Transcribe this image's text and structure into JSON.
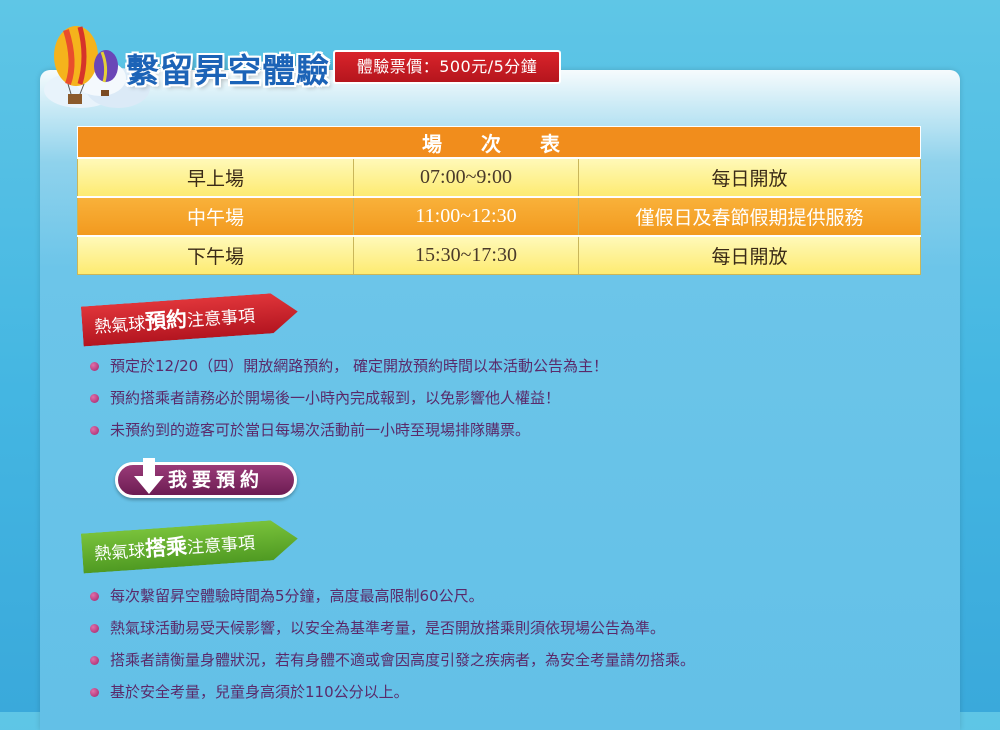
{
  "header": {
    "title": "繫留昇空體驗",
    "price": "體驗票價：500元/5分鐘"
  },
  "schedule": {
    "heading": "場 次 表",
    "rows": [
      {
        "session": "早上場",
        "time": "07:00~9:00",
        "note": "每日開放"
      },
      {
        "session": "中午場",
        "time": "11:00~12:30",
        "note": "僅假日及春節假期提供服務"
      },
      {
        "session": "下午場",
        "time": "15:30~17:30",
        "note": "每日開放"
      }
    ]
  },
  "booking_notice": {
    "prefix": "熱氣球",
    "bold": "預約",
    "suffix": "注意事項",
    "items": [
      "預定於12/20（四）開放網路預約， 確定開放預約時間以本活動公告為主！",
      "預約搭乘者請務必於開場後一小時內完成報到，以免影響他人權益！",
      "未預約到的遊客可於當日每場次活動前一小時至現場排隊購票。"
    ]
  },
  "book_button": {
    "label": "我要預約",
    "icon": "down-arrow-icon"
  },
  "ride_notice": {
    "prefix": "熱氣球",
    "bold": "搭乘",
    "suffix": "注意事項",
    "items": [
      "每次繫留昇空體驗時間為5分鐘，高度最高限制60公尺。",
      "熱氣球活動易受天候影響，以安全為基準考量，是否開放搭乘則須依現場公告為準。",
      "搭乘者請衡量身體狀況，若有身體不適或會因高度引發之疾病者，為安全考量請勿搭乘。",
      "基於安全考量，兒童身高須於110公分以上。"
    ]
  },
  "colors": {
    "background": "#4ab9e3",
    "table_header": "#f18d1c",
    "row_yellow": "#fdeb72",
    "row_orange": "#f29a1f",
    "ribbon_red": "#c41f27",
    "ribbon_green": "#5aa82a",
    "button": "#7d2460",
    "title": "#1c63b7"
  }
}
